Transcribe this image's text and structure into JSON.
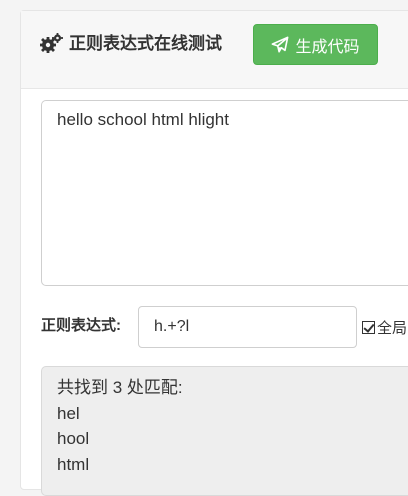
{
  "header": {
    "icon": "gears-icon",
    "title": "正则表达式在线测试",
    "generate_button": {
      "icon": "paper-plane-icon",
      "label": "生成代码"
    }
  },
  "test_text": {
    "value": "hello school html hlight"
  },
  "regex": {
    "label": "正则表达式:",
    "value": "h.+?l"
  },
  "global_option": {
    "checked": true,
    "label": "全局"
  },
  "result": {
    "summary": "共找到 3 处匹配:",
    "matches": [
      "hel",
      "hool",
      "html"
    ]
  },
  "colors": {
    "button": "#5cb85c",
    "result_bg": "#eeeeee"
  }
}
